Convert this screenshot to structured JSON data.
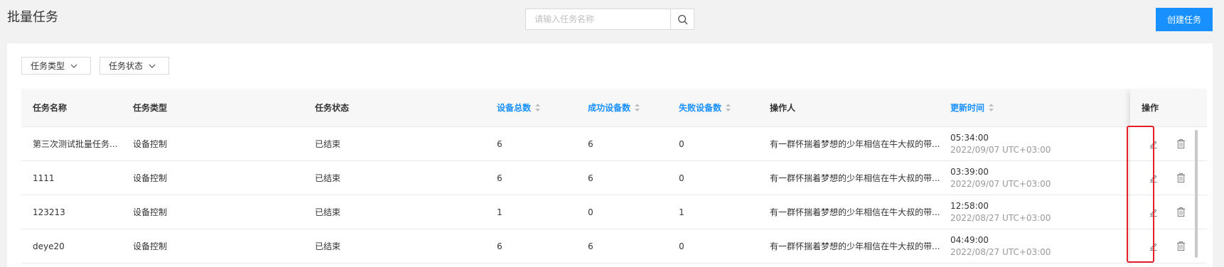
{
  "header": {
    "title": "批量任务",
    "search_placeholder": "请输入任务名称",
    "search_icon": "search-icon",
    "create_label": "创建任务"
  },
  "colors": {
    "accent": "#1890ff",
    "highlight": "#e5202a",
    "page_bg": "#f2f2f2"
  },
  "filters": [
    {
      "label": "任务类型",
      "icon": "chevron-down-icon"
    },
    {
      "label": "任务状态",
      "icon": "chevron-down-icon"
    }
  ],
  "table": {
    "columns": {
      "name": "任务名称",
      "type": "任务类型",
      "status": "任务状态",
      "total": "设备总数",
      "success": "成功设备数",
      "failed": "失败设备数",
      "operator": "操作人",
      "updated": "更新时间",
      "actions": "操作"
    },
    "sortable": [
      "total",
      "success",
      "failed",
      "updated"
    ],
    "rows": [
      {
        "name": "第三次测试批量任务...",
        "type": "设备控制",
        "status": "已结束",
        "total": "6",
        "success": "6",
        "failed": "0",
        "operator": "有一群怀揣着梦想的少年相信在牛大叔的带...",
        "time": "05:34:00",
        "date": "2022/09/07 UTC+03:00"
      },
      {
        "name": "1111",
        "type": "设备控制",
        "status": "已结束",
        "total": "6",
        "success": "6",
        "failed": "0",
        "operator": "有一群怀揣着梦想的少年相信在牛大叔的带...",
        "time": "03:39:00",
        "date": "2022/09/07 UTC+03:00"
      },
      {
        "name": "123213",
        "type": "设备控制",
        "status": "已结束",
        "total": "1",
        "success": "0",
        "failed": "1",
        "operator": "有一群怀揣着梦想的少年相信在牛大叔的带...",
        "time": "12:58:00",
        "date": "2022/08/27 UTC+03:00"
      },
      {
        "name": "deye20",
        "type": "设备控制",
        "status": "已结束",
        "total": "6",
        "success": "6",
        "failed": "0",
        "operator": "有一群怀揣着梦想的少年相信在牛大叔的带...",
        "time": "04:49:00",
        "date": "2022/08/27 UTC+03:00"
      }
    ],
    "row_actions": [
      "edit-icon",
      "trash-icon"
    ]
  }
}
